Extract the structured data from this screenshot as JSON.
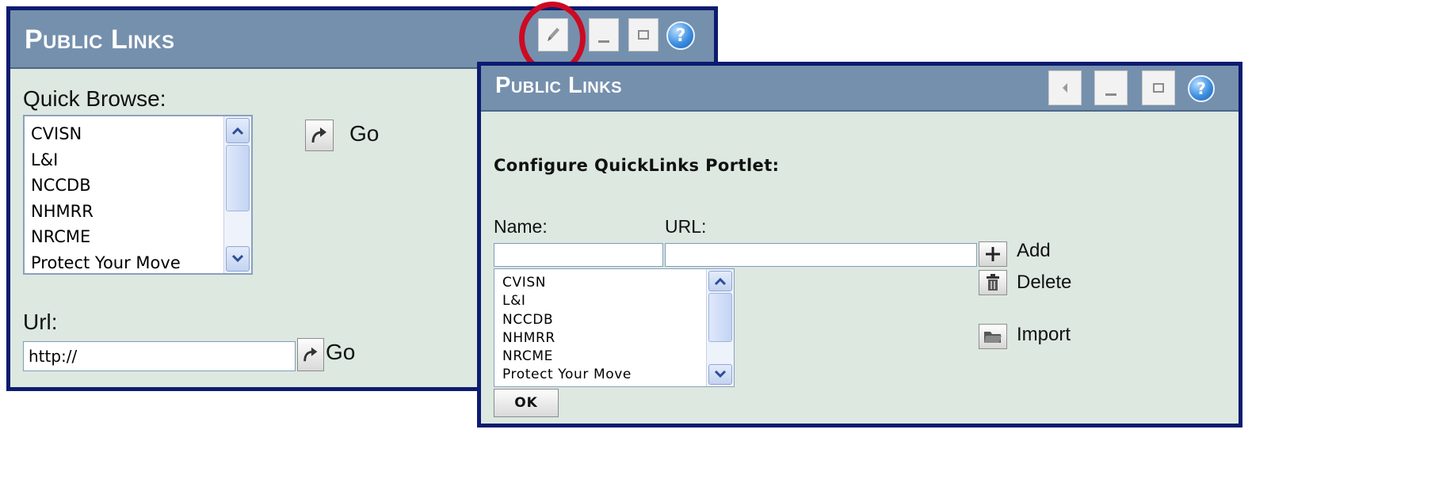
{
  "back_portlet": {
    "title": "Public Links",
    "title_buttons": [
      "pencil-icon",
      "minimize-icon",
      "maximize-icon",
      "help-icon"
    ],
    "help_glyph": "?",
    "quick_browse_label": "Quick Browse:",
    "list_items": [
      "CVISN",
      "L&I",
      "NCCDB",
      "NHMRR",
      "NRCME",
      "Protect Your Move"
    ],
    "go_label": "Go",
    "url_label": "Url:",
    "url_value": "http://",
    "url_go_label": "Go"
  },
  "front_portlet": {
    "title": "Public Links",
    "title_buttons": [
      "back-arrow-icon",
      "minimize-icon",
      "maximize-icon",
      "help-icon"
    ],
    "help_glyph": "?",
    "heading": "Configure QuickLinks Portlet:",
    "name_label": "Name:",
    "url_label": "URL:",
    "name_value": "",
    "url_value": "",
    "list_items": [
      "CVISN",
      "L&I",
      "NCCDB",
      "NHMRR",
      "NRCME",
      "Protect Your Move"
    ],
    "add_label": "Add",
    "delete_label": "Delete",
    "import_label": "Import",
    "ok_label": "OK"
  },
  "highlight": {
    "color": "#cc0a22",
    "target": "pencil-icon"
  },
  "colors": {
    "frame": "#0d1b70",
    "titlebar": "#7590ad",
    "body": "#dce8e0"
  }
}
